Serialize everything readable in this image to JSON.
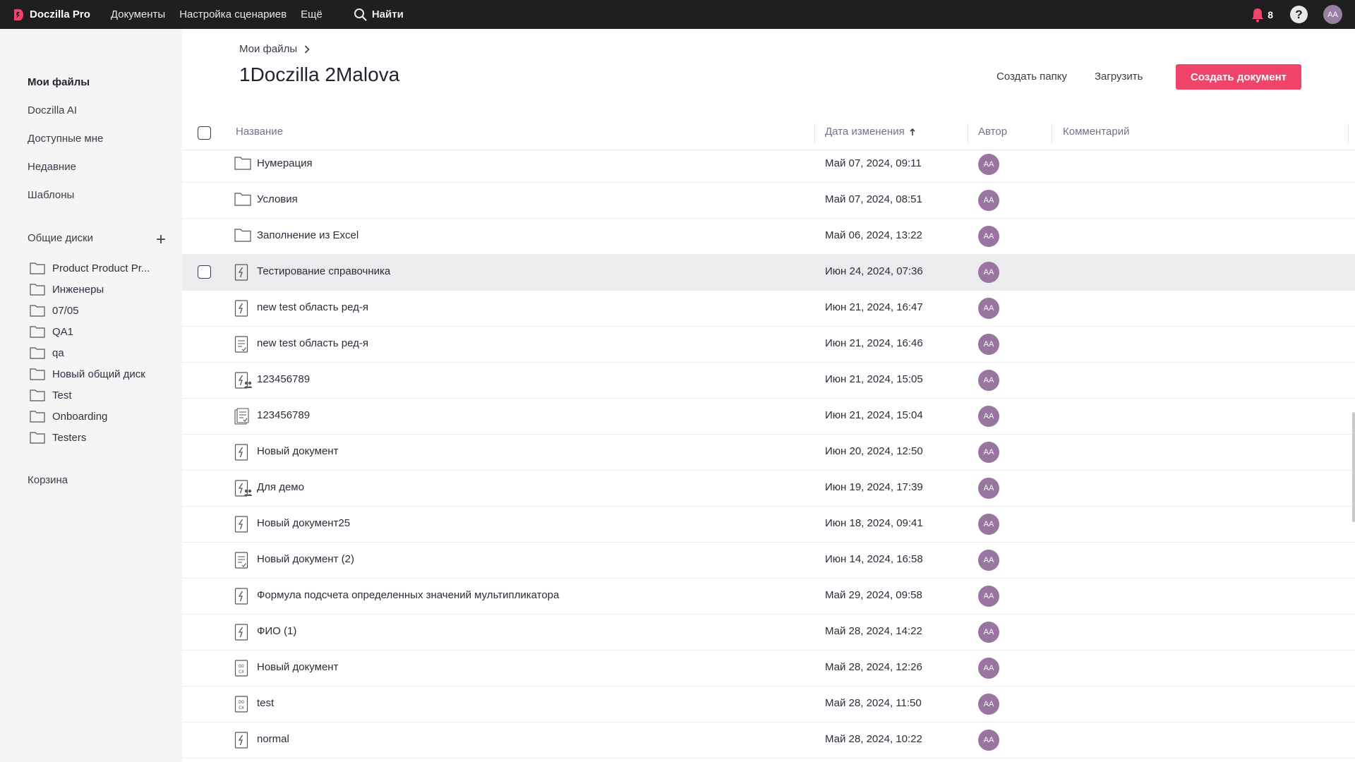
{
  "topbar": {
    "brand": "Doczilla Pro",
    "nav": [
      "Документы",
      "Настройка сценариев",
      "Ещё"
    ],
    "search_label": "Найти",
    "notification_count": "8",
    "help": "?",
    "user_initials": "AA"
  },
  "sidebar": {
    "links": [
      "Мои файлы",
      "Doczilla AI",
      "Доступные мне",
      "Недавние",
      "Шаблоны"
    ],
    "shared_header": "Общие диски",
    "add_symbol": "+",
    "disks": [
      "Product Product Pr...",
      "Инженеры",
      "07/05",
      "QA1",
      "qa",
      "Новый общий диск",
      "Test",
      "Onboarding",
      "Testers"
    ],
    "trash": "Корзина"
  },
  "main": {
    "breadcrumb": "Мои файлы",
    "title": "1Doczilla 2Malova",
    "create_folder": "Создать папку",
    "upload": "Загрузить",
    "create_document": "Создать документ"
  },
  "table": {
    "columns": {
      "name": "Название",
      "date": "Дата изменения",
      "author": "Автор",
      "comment": "Комментарий"
    },
    "rows": [
      {
        "type": "folder",
        "name": "Нумерация",
        "date": "Май 07, 2024, 09:11",
        "author": "AA"
      },
      {
        "type": "folder",
        "name": "Условия",
        "date": "Май 07, 2024, 08:51",
        "author": "AA"
      },
      {
        "type": "folder",
        "name": "Заполнение из Excel",
        "date": "Май 06, 2024, 13:22",
        "author": "AA"
      },
      {
        "type": "smart",
        "name": "Тестирование справочника",
        "date": "Июн 24, 2024, 07:36",
        "author": "AA"
      },
      {
        "type": "smart",
        "name": "new test область ред-я",
        "date": "Июн 21, 2024, 16:47",
        "author": "AA"
      },
      {
        "type": "doc",
        "name": "new test область ред-я",
        "date": "Июн 21, 2024, 16:46",
        "author": "AA"
      },
      {
        "type": "smart-shared",
        "name": "123456789",
        "date": "Июн 21, 2024, 15:05",
        "author": "AA"
      },
      {
        "type": "doc-stack",
        "name": "123456789",
        "date": "Июн 21, 2024, 15:04",
        "author": "AA"
      },
      {
        "type": "smart",
        "name": "Новый документ",
        "date": "Июн 20, 2024, 12:50",
        "author": "AA"
      },
      {
        "type": "smart-shared",
        "name": "Для демо",
        "date": "Июн 19, 2024, 17:39",
        "author": "AA"
      },
      {
        "type": "smart",
        "name": "Новый документ25",
        "date": "Июн 18, 2024, 09:41",
        "author": "AA"
      },
      {
        "type": "doc",
        "name": "Новый документ (2)",
        "date": "Июн 14, 2024, 16:58",
        "author": "AA"
      },
      {
        "type": "smart",
        "name": "Формула подсчета определенных значений мультипликатора",
        "date": "Май 29, 2024, 09:58",
        "author": "AA"
      },
      {
        "type": "smart",
        "name": "ФИО (1)",
        "date": "Май 28, 2024, 14:22",
        "author": "AA"
      },
      {
        "type": "docx",
        "name": "Новый документ",
        "date": "Май 28, 2024, 12:26",
        "author": "AA"
      },
      {
        "type": "docx",
        "name": "test",
        "date": "Май 28, 2024, 11:50",
        "author": "AA"
      },
      {
        "type": "smart",
        "name": "normal",
        "date": "Май 28, 2024, 10:22",
        "author": "AA"
      }
    ]
  },
  "colors": {
    "topbar": "#1f1f1f",
    "primary": "#f0446a",
    "avatar": "#98769f",
    "highlight_row": "#ececef"
  }
}
